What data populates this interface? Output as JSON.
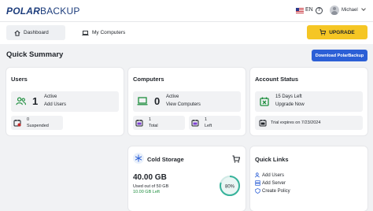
{
  "app": {
    "logo_bold": "POLAR",
    "logo_regular": "BACKUP",
    "language": "EN",
    "user_name": "Michael"
  },
  "tabs": [
    {
      "label": "Dashboard"
    },
    {
      "label": "My Computers"
    }
  ],
  "upgrade_label": "UPGRADE",
  "summary": {
    "title": "Quick Summary",
    "download_label": "Download PolarBackup"
  },
  "users": {
    "title": "Users",
    "active_count": "1",
    "active_label": "Active",
    "active_link": "Add Users",
    "suspended_count": "0",
    "suspended_label": "Suspended"
  },
  "computers": {
    "title": "Computers",
    "active_count": "0",
    "active_label": "Active",
    "active_link": "View Computers",
    "total_count": "1",
    "total_label": "Total",
    "left_count": "1",
    "left_label": "Left"
  },
  "account": {
    "title": "Account Status",
    "days_left": "15 Days Left",
    "upgrade_link": "Upgrade Now",
    "trial_text": "Trial expires on 7/23/2024"
  },
  "cold_storage": {
    "title": "Cold Storage",
    "used": "40.00 GB",
    "used_of": "Used out of 50 GB",
    "left": "10.00 GB Left",
    "percent": "80%",
    "fraction": 0.8
  },
  "quick_links": {
    "title": "Quick Links",
    "items": [
      "Add Users",
      "Add Server",
      "Create Policy"
    ]
  },
  "colors": {
    "accent": "#2c5fd6",
    "green": "#1e8e3e",
    "upgrade": "#f5c624",
    "danger": "#c62828"
  }
}
